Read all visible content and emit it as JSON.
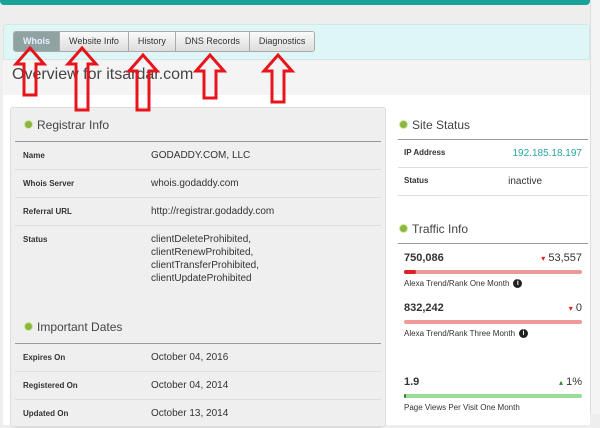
{
  "tabs": [
    {
      "label": "Whois",
      "active": true
    },
    {
      "label": "Website Info"
    },
    {
      "label": "History"
    },
    {
      "label": "DNS Records"
    },
    {
      "label": "Diagnostics"
    }
  ],
  "page_title": "Overview for itsardar.com",
  "registrar": {
    "heading": "Registrar Info",
    "rows": [
      {
        "k": "Name",
        "v": "GODADDY.COM, LLC"
      },
      {
        "k": "Whois Server",
        "v": "whois.godaddy.com"
      },
      {
        "k": "Referral URL",
        "v": "http://registrar.godaddy.com"
      },
      {
        "k": "Status",
        "v": [
          "clientDeleteProhibited,",
          "clientRenewProhibited,",
          "clientTransferProhibited,",
          "clientUpdateProhibited"
        ]
      }
    ]
  },
  "dates": {
    "heading": "Important Dates",
    "rows": [
      {
        "k": "Expires On",
        "v": "October 04, 2016"
      },
      {
        "k": "Registered On",
        "v": "October 04, 2014"
      },
      {
        "k": "Updated On",
        "v": "October 13, 2014"
      }
    ]
  },
  "site_status": {
    "heading": "Site Status",
    "ip_label": "IP Address",
    "ip": "192.185.18.197",
    "status_label": "Status",
    "status": "inactive"
  },
  "traffic": {
    "heading": "Traffic Info",
    "items": [
      {
        "value": "750,086",
        "change": "▾ 53,557",
        "caption": "Alexa Trend/Rank One Month",
        "fill": 0.07,
        "trend": "down",
        "info": "i"
      },
      {
        "value": "832,242",
        "change": "▾ 0",
        "caption": "Alexa Trend/Rank Three Month",
        "fill": 0,
        "trend": "down",
        "info": "i"
      },
      {
        "value": "1.9",
        "change": "▴ 1%",
        "caption": "Page Views Per Visit One Month",
        "fill": 0.01,
        "trend": "up"
      }
    ]
  },
  "colors": {
    "accent": "#17a398",
    "link": "#2aa5a0",
    "down": "#e02020",
    "up": "#2a8a2a"
  }
}
